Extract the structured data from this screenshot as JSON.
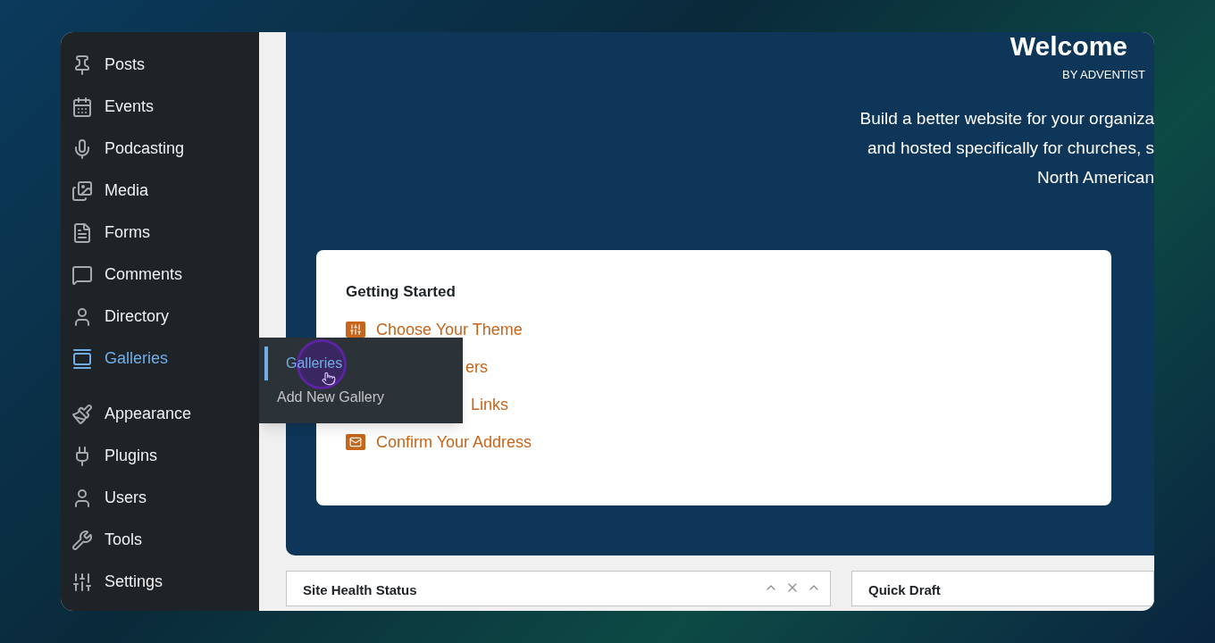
{
  "sidebar": {
    "items": [
      {
        "label": "Posts",
        "selected": false
      },
      {
        "label": "Events",
        "selected": false
      },
      {
        "label": "Podcasting",
        "selected": false
      },
      {
        "label": "Media",
        "selected": false
      },
      {
        "label": "Forms",
        "selected": false
      },
      {
        "label": "Comments",
        "selected": false
      },
      {
        "label": "Directory",
        "selected": false
      },
      {
        "label": "Galleries",
        "selected": true
      },
      {
        "label": "Appearance",
        "selected": false
      },
      {
        "label": "Plugins",
        "selected": false
      },
      {
        "label": "Users",
        "selected": false
      },
      {
        "label": "Tools",
        "selected": false
      },
      {
        "label": "Settings",
        "selected": false
      }
    ]
  },
  "flyout": {
    "items": [
      {
        "label": "Galleries",
        "selected": true
      },
      {
        "label": "Add New Gallery",
        "selected": false
      }
    ]
  },
  "banner": {
    "title": "Welcome",
    "byline": "BY ADVENTIST",
    "lines": [
      "Build a better website for your organiza",
      "and hosted specifically for churches, s",
      "North American"
    ]
  },
  "getting_started": {
    "title": "Getting Started",
    "links": [
      {
        "kind": "icon",
        "label": "Choose Your Theme"
      },
      {
        "kind": "covered",
        "label": "ers"
      },
      {
        "kind": "covered",
        "label": "Links"
      },
      {
        "kind": "icon",
        "label": "Confirm Your Address"
      }
    ]
  },
  "panels": [
    {
      "title": "Site Health Status"
    },
    {
      "title": "Quick Draft"
    }
  ]
}
